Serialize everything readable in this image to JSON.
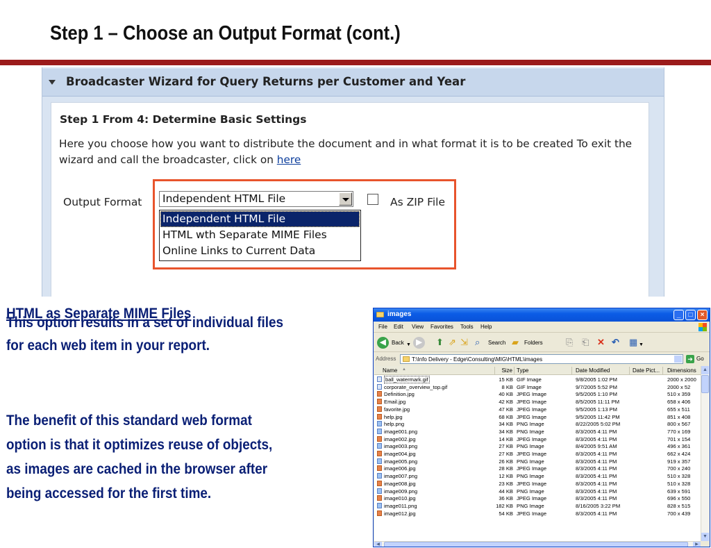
{
  "slide": {
    "title": "Step 1 – Choose an Output Format (cont.)"
  },
  "wizard": {
    "title": "Broadcaster Wizard for Query Returns per Customer and Year",
    "step_heading": "Step 1 From 4: Determine Basic Settings",
    "description": "Here you choose how you want to distribute the document and in what format it is to be created To exit the wizard and call the broadcaster, click on",
    "link_text": "here",
    "output_format_label": "Output Format",
    "output_format_value": "Independent HTML File",
    "zip_label": "As ZIP File",
    "zip_checked": false,
    "options": [
      "Independent HTML File",
      "HTML wth Separate MIME Files",
      "Online Links to Current Data"
    ],
    "selected_option_index": 0,
    "highlight_color": "#e8542c"
  },
  "text": {
    "heading": "HTML as Separate MIME Files",
    "p1_line1": "This option results in a set of individual files",
    "p1_line2": "for each web item in your report.",
    "p2_line1": "The benefit of this standard web format",
    "p2_line2": "option is that it optimizes reuse of objects,",
    "p2_line3": "as images are cached in the browser after",
    "p2_line4": "being accessed for the first time.",
    "color": "#0a1f75"
  },
  "explorer": {
    "title": "images",
    "menu": [
      "File",
      "Edit",
      "View",
      "Favorites",
      "Tools",
      "Help"
    ],
    "toolbar": {
      "back_label": "Back",
      "search_label": "Search",
      "folders_label": "Folders"
    },
    "address_label": "Address",
    "address": "T:\\Info Delivery - Edge\\Consulting\\MIG\\HTML\\images",
    "go_label": "Go",
    "columns": [
      "Name",
      "Size",
      "Type",
      "Date Modified",
      "Date Pict...",
      "Dimensions"
    ],
    "files": [
      {
        "name": "ball_watermark.gif",
        "size": "15 KB",
        "type": "GIF Image",
        "modified": "9/8/2005 1:02 PM",
        "dims": "2000 x 2000",
        "icon": "gif"
      },
      {
        "name": "corporate_overview_top.gif",
        "size": "8 KB",
        "type": "GIF Image",
        "modified": "9/7/2005 5:52 PM",
        "dims": "2000 x 52",
        "icon": "gif"
      },
      {
        "name": "Definition.jpg",
        "size": "40 KB",
        "type": "JPEG Image",
        "modified": "9/5/2005 1:10 PM",
        "dims": "510 x 359",
        "icon": "jpg"
      },
      {
        "name": "Email.jpg",
        "size": "42 KB",
        "type": "JPEG Image",
        "modified": "8/5/2005 11:11 PM",
        "dims": "658 x 406",
        "icon": "jpg"
      },
      {
        "name": "favorite.jpg",
        "size": "47 KB",
        "type": "JPEG Image",
        "modified": "9/5/2005 1:13 PM",
        "dims": "655 x 511",
        "icon": "jpg"
      },
      {
        "name": "help.jpg",
        "size": "68 KB",
        "type": "JPEG Image",
        "modified": "9/5/2005 11:42 PM",
        "dims": "851 x 408",
        "icon": "jpg"
      },
      {
        "name": "help.png",
        "size": "34 KB",
        "type": "PNG Image",
        "modified": "8/22/2005 5:02 PM",
        "dims": "800 x 567",
        "icon": "png"
      },
      {
        "name": "image001.png",
        "size": "34 KB",
        "type": "PNG Image",
        "modified": "8/3/2005 4:11 PM",
        "dims": "770 x 169",
        "icon": "png"
      },
      {
        "name": "image002.jpg",
        "size": "14 KB",
        "type": "JPEG Image",
        "modified": "8/3/2005 4:11 PM",
        "dims": "701 x 154",
        "icon": "jpg"
      },
      {
        "name": "image003.png",
        "size": "27 KB",
        "type": "PNG Image",
        "modified": "8/4/2005 9:51 AM",
        "dims": "496 x 361",
        "icon": "png"
      },
      {
        "name": "image004.jpg",
        "size": "27 KB",
        "type": "JPEG Image",
        "modified": "8/3/2005 4:11 PM",
        "dims": "662 x 424",
        "icon": "jpg"
      },
      {
        "name": "image005.png",
        "size": "26 KB",
        "type": "PNG Image",
        "modified": "8/3/2005 4:11 PM",
        "dims": "919 x 357",
        "icon": "png"
      },
      {
        "name": "image006.jpg",
        "size": "28 KB",
        "type": "JPEG Image",
        "modified": "8/3/2005 4:11 PM",
        "dims": "700 x 240",
        "icon": "jpg"
      },
      {
        "name": "image007.png",
        "size": "12 KB",
        "type": "PNG Image",
        "modified": "8/3/2005 4:11 PM",
        "dims": "510 x 328",
        "icon": "png"
      },
      {
        "name": "image008.jpg",
        "size": "23 KB",
        "type": "JPEG Image",
        "modified": "8/3/2005 4:11 PM",
        "dims": "510 x 328",
        "icon": "jpg"
      },
      {
        "name": "image009.png",
        "size": "44 KB",
        "type": "PNG Image",
        "modified": "8/3/2005 4:11 PM",
        "dims": "639 x 591",
        "icon": "png"
      },
      {
        "name": "image010.jpg",
        "size": "36 KB",
        "type": "JPEG Image",
        "modified": "8/3/2005 4:11 PM",
        "dims": "696 x 550",
        "icon": "jpg"
      },
      {
        "name": "image011.png",
        "size": "182 KB",
        "type": "PNG Image",
        "modified": "8/16/2005 3:22 PM",
        "dims": "828 x 515",
        "icon": "png"
      },
      {
        "name": "image012.jpg",
        "size": "54 KB",
        "type": "JPEG Image",
        "modified": "8/3/2005 4:11 PM",
        "dims": "700 x 439",
        "icon": "jpg"
      }
    ]
  }
}
